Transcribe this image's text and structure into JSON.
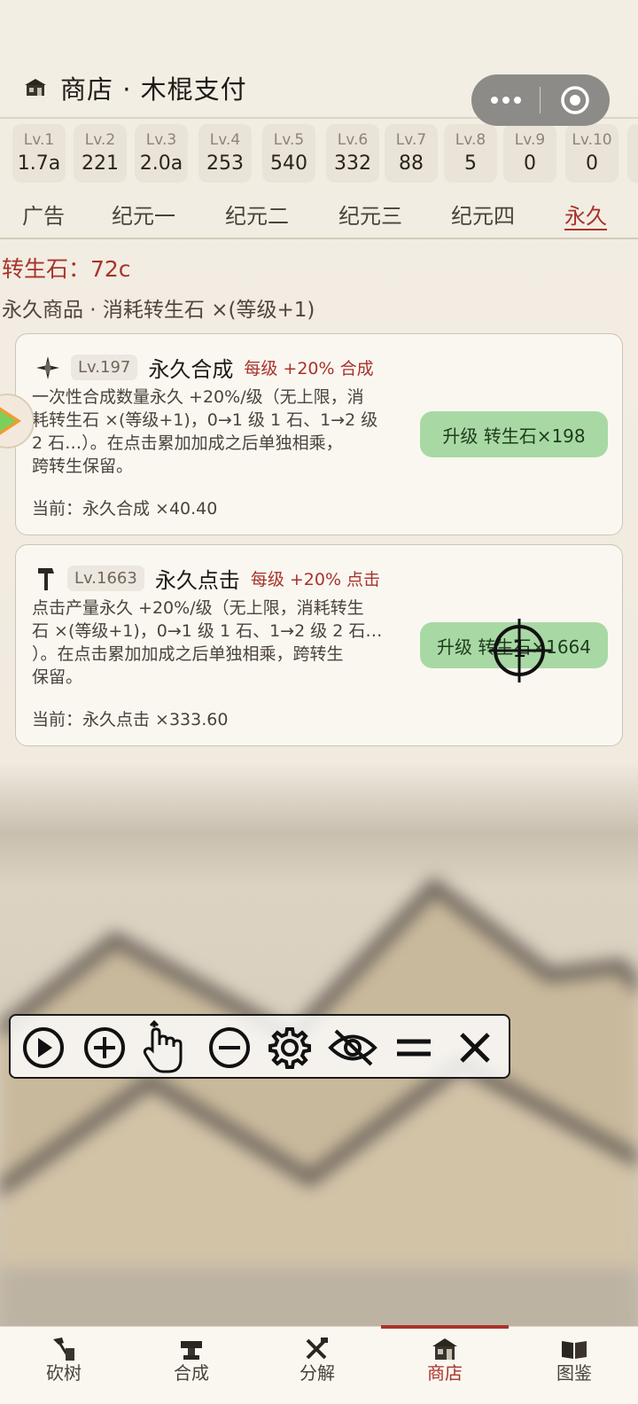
{
  "header": {
    "title": "商店 · 木棍支付"
  },
  "levels": [
    {
      "label": "Lv.1",
      "value": "1.7a"
    },
    {
      "label": "Lv.2",
      "value": "221"
    },
    {
      "label": "Lv.3",
      "value": "2.0a"
    },
    {
      "label": "Lv.4",
      "value": "253"
    },
    {
      "label": "Lv.5",
      "value": "540"
    },
    {
      "label": "Lv.6",
      "value": "332"
    },
    {
      "label": "Lv.7",
      "value": "88"
    },
    {
      "label": "Lv.8",
      "value": "5"
    },
    {
      "label": "Lv.9",
      "value": "0"
    },
    {
      "label": "Lv.10",
      "value": "0"
    }
  ],
  "tabs": [
    {
      "label": "广告",
      "active": false
    },
    {
      "label": "纪元一",
      "active": false
    },
    {
      "label": "纪元二",
      "active": false
    },
    {
      "label": "纪元三",
      "active": false
    },
    {
      "label": "纪元四",
      "active": false
    },
    {
      "label": "永久",
      "active": true
    }
  ],
  "currency": {
    "text": "转生石：72c"
  },
  "section": {
    "subtitle": "永久商品 · 消耗转生石 ×(等级+1)"
  },
  "cards": [
    {
      "icon": "compass-star-icon",
      "level": "Lv.197",
      "name": "永久合成",
      "effect": "每级 +20% 合成",
      "desc_lines": [
        "一次性合成数量永久 +20%/级（无上限，消",
        "耗转生石 ×(等级+1)，0→1 级 1 石、1→2 级",
        "2 石…）。在点击累加加成之后单独相乘，",
        "跨转生保留。"
      ],
      "current": "当前：永久合成 ×40.40",
      "button": "升级 转生石×198"
    },
    {
      "icon": "hammer-icon",
      "level": "Lv.1663",
      "name": "永久点击",
      "effect": "每级 +20% 点击",
      "desc_lines": [
        "点击产量永久 +20%/级（无上限，消耗转生",
        "石 ×(等级+1)，0→1 级 1 石、1→2 级 2 石…",
        "）。在点击累加加成之后单独相乘，跨转生",
        "保留。"
      ],
      "current": "当前：永久点击 ×333.60",
      "button": "升级 转生石×1664"
    }
  ],
  "crosshair": {
    "label": "1"
  },
  "toolbar": [
    "play-icon",
    "plus-circle-icon",
    "tap-hand-icon",
    "minus-circle-icon",
    "gear-icon",
    "eye-off-icon",
    "equals-icon",
    "close-icon"
  ],
  "nav": [
    {
      "label": "砍树",
      "icon": "axe-tree-icon",
      "active": false
    },
    {
      "label": "合成",
      "icon": "anvil-icon",
      "active": false
    },
    {
      "label": "分解",
      "icon": "tools-icon",
      "active": false
    },
    {
      "label": "商店",
      "icon": "shop-icon",
      "active": true
    },
    {
      "label": "图鉴",
      "icon": "book-icon",
      "active": false
    }
  ],
  "colors": {
    "accent": "#a8332b",
    "button_green": "#a8d9a4",
    "background": "#f3eee4"
  }
}
